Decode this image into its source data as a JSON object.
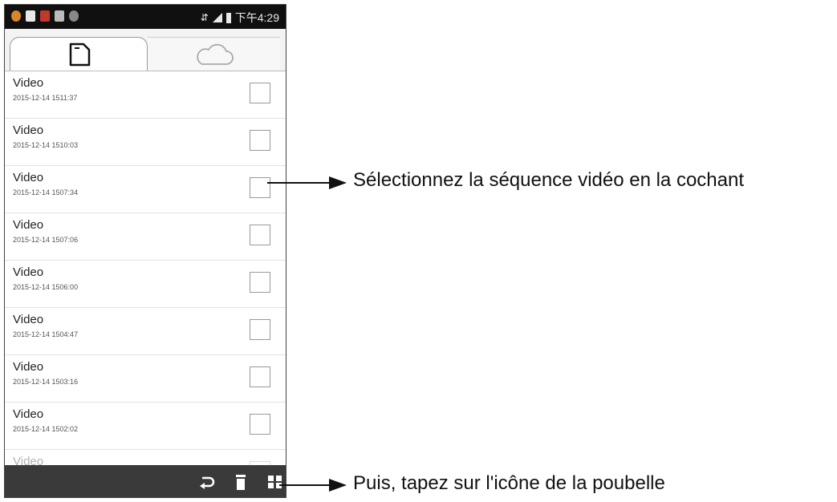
{
  "statusbar": {
    "time": "下午4:29",
    "icons": [
      "notification-icon",
      "sd-icon",
      "app-icon",
      "storage-icon",
      "settings-icon",
      "wifi-icon",
      "signal-icon",
      "battery-icon"
    ]
  },
  "tabs": [
    {
      "name": "local-files",
      "icon": "sd-card-icon",
      "active": true
    },
    {
      "name": "cloud",
      "icon": "cloud-icon",
      "active": false
    }
  ],
  "videos": [
    {
      "title": "Video",
      "date": "2015-12-14 1511:37"
    },
    {
      "title": "Video",
      "date": "2015-12-14 1510:03"
    },
    {
      "title": "Video",
      "date": "2015-12-14 1507:34"
    },
    {
      "title": "Video",
      "date": "2015-12-14 1507:06"
    },
    {
      "title": "Video",
      "date": "2015-12-14 1506:00"
    },
    {
      "title": "Video",
      "date": "2015-12-14 1504:47"
    },
    {
      "title": "Video",
      "date": "2015-12-14 1503:16"
    },
    {
      "title": "Video",
      "date": "2015-12-14 1502:02"
    },
    {
      "title": "Video",
      "date": ""
    }
  ],
  "bottombar": {
    "icons": [
      "back-icon",
      "trash-icon",
      "grid-icon"
    ]
  },
  "annotations": {
    "select": "Sélectionnez la séquence vidéo en la cochant",
    "delete": "Puis, tapez sur l'icône de la poubelle"
  }
}
